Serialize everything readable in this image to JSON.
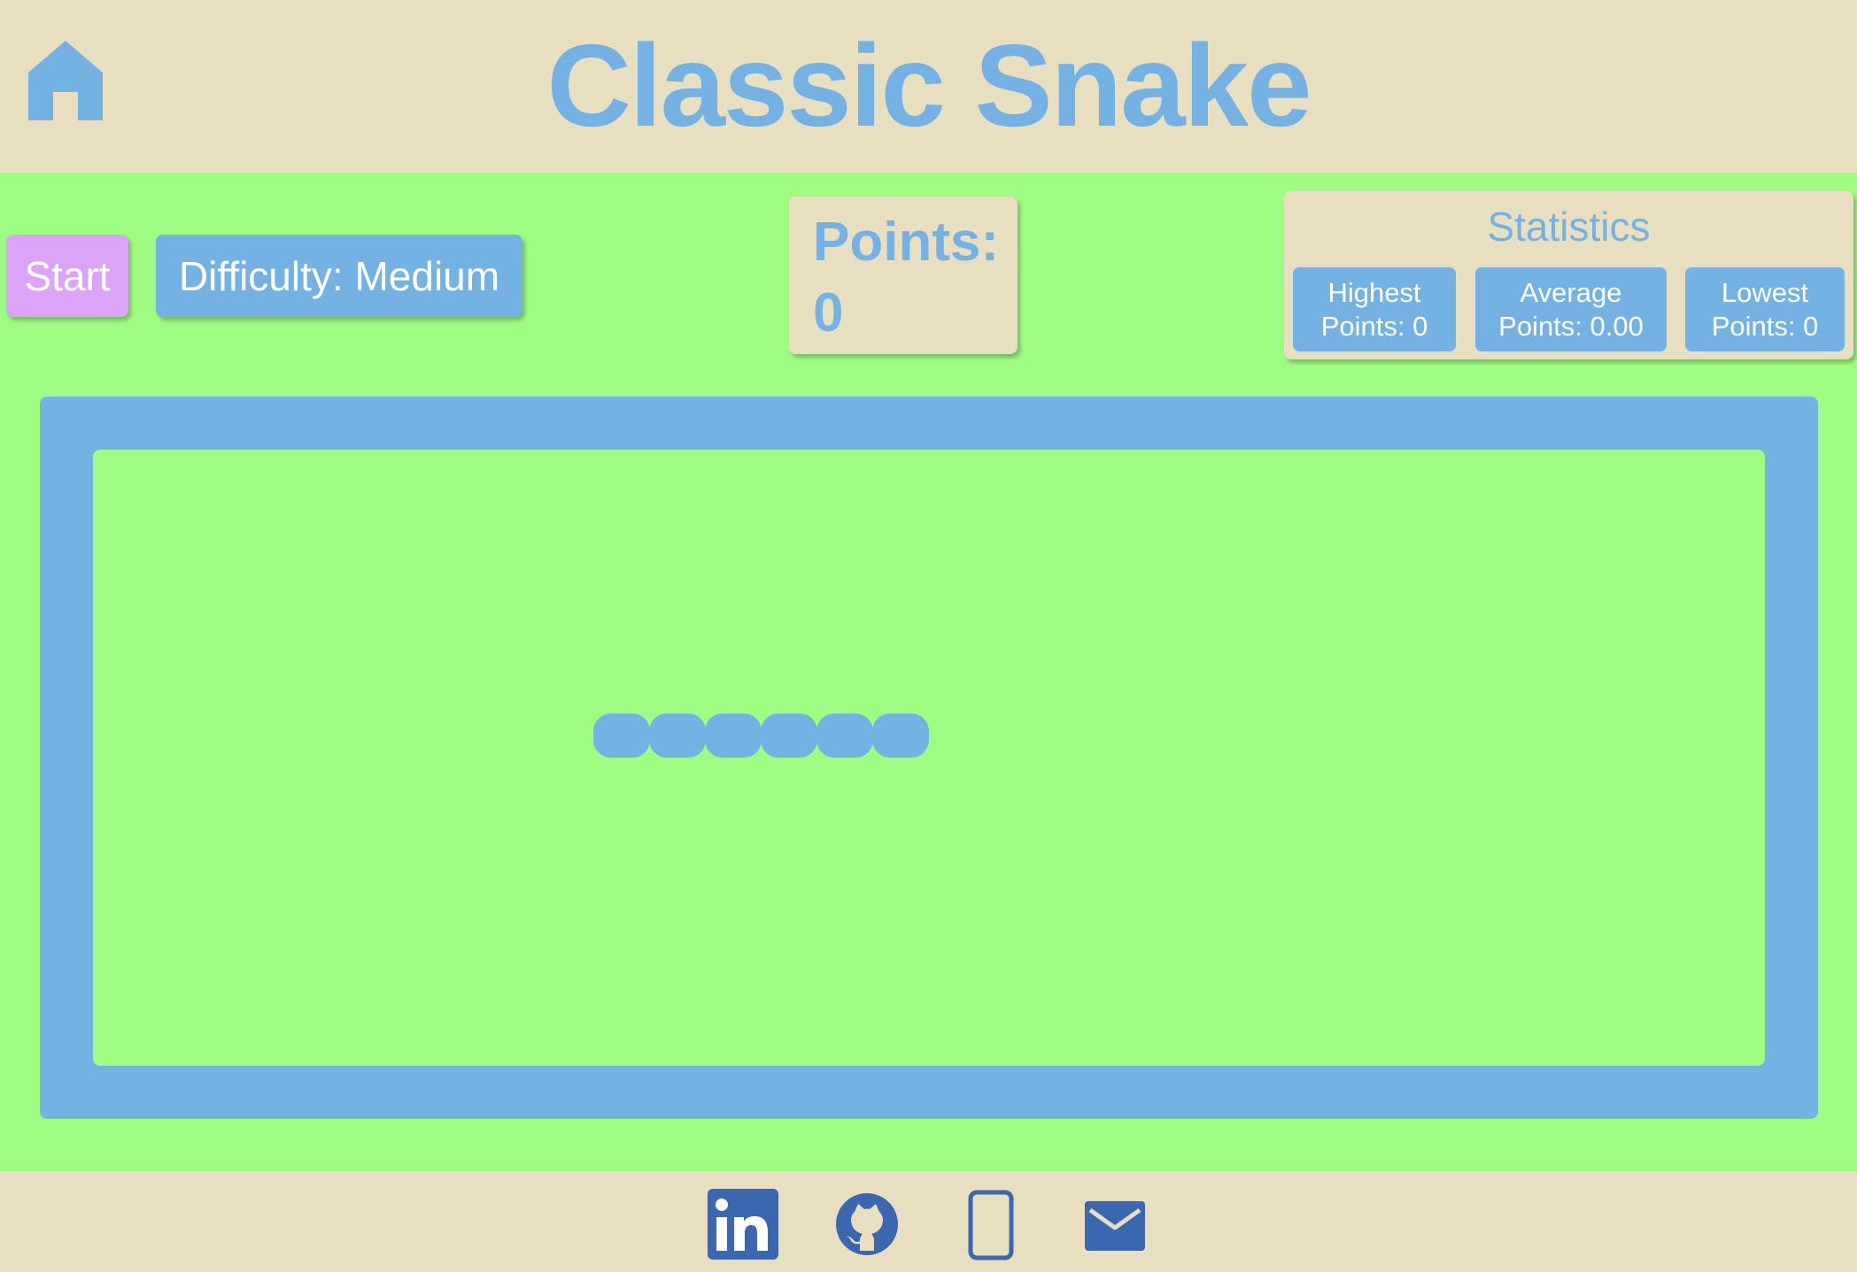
{
  "header": {
    "title": "Classic Snake",
    "home_icon": "home-icon"
  },
  "controls": {
    "start_label": "Start",
    "difficulty_label": "Difficulty: Medium"
  },
  "points": {
    "label": "Points:",
    "value": "0"
  },
  "statistics": {
    "title": "Statistics",
    "highest": {
      "line1": "Highest",
      "line2": "Points: 0"
    },
    "average": {
      "line1": "Average",
      "line2": "Points: 0.00"
    },
    "lowest": {
      "line1": "Lowest",
      "line2": "Points: 0"
    }
  },
  "game": {
    "snake_length": 6
  },
  "footer": {
    "icons": [
      "linkedin-icon",
      "github-icon",
      "phone-icon",
      "mail-icon"
    ]
  },
  "colors": {
    "accent_blue": "#75b2e4",
    "field_green": "#9ffc83",
    "panel_beige": "#e8dfc0",
    "start_purple": "#dca4f6",
    "footer_icon_blue": "#3b66b0"
  }
}
